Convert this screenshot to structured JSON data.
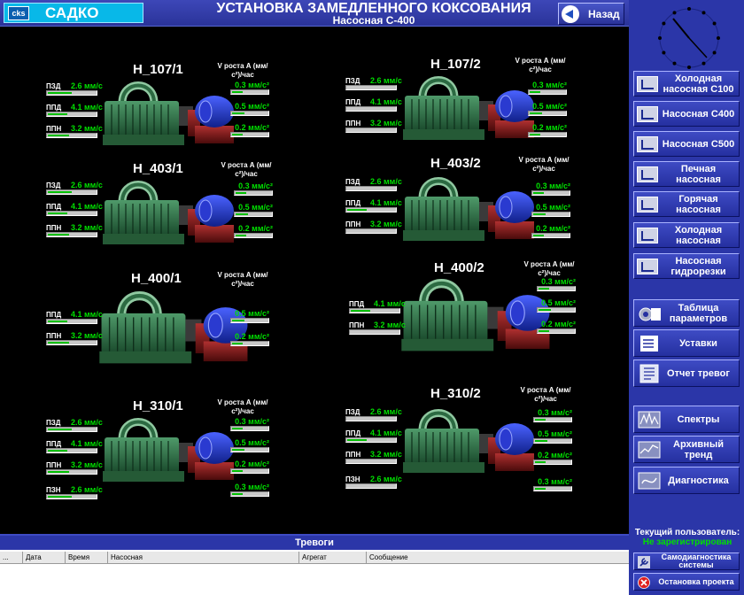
{
  "header": {
    "logo_text": "САДКО",
    "logo_icon": "cks",
    "title": "УСТАНОВКА ЗАМЕДЛЕННОГО КОКСОВАНИЯ",
    "subtitle": "Насосная С-400",
    "back_label": "Назад",
    "accent": "#2b36a8"
  },
  "pumps": [
    {
      "name": "Н_107/1",
      "vhead": "V роста А (мм/с²)/час",
      "sensors": [
        {
          "label": "ПЗД",
          "value": "2.6 мм/с",
          "fill": 0.5
        },
        {
          "label": "ППД",
          "value": "4.1 мм/с",
          "fill": 0.4
        },
        {
          "label": "ППН",
          "value": "3.2 мм/с",
          "fill": 0.45
        }
      ],
      "v": [
        {
          "value": "0.3 мм/с²",
          "fill": 0.3
        },
        {
          "value": "0.5 мм/с²",
          "fill": 0.35
        },
        {
          "value": "0.2 мм/с²",
          "fill": 0.3
        }
      ]
    },
    {
      "name": "Н_107/2",
      "vhead": "V роста А (мм/с²)/час",
      "sensors": [
        {
          "label": "ПЗД",
          "value": "2.6 мм/с",
          "fill": 0.0
        },
        {
          "label": "ППД",
          "value": "4.1 мм/с",
          "fill": 0.0
        },
        {
          "label": "ППН",
          "value": "3.2 мм/с",
          "fill": 0.0
        }
      ],
      "v": [
        {
          "value": "0.3 мм/с²",
          "fill": 0.3
        },
        {
          "value": "0.5 мм/с²",
          "fill": 0.35
        },
        {
          "value": "0.2 мм/с²",
          "fill": 0.3
        }
      ]
    },
    {
      "name": "Н_403/1",
      "vhead": "V роста А (мм/с²)/час",
      "sensors": [
        {
          "label": "ПЗД",
          "value": "2.6 мм/с",
          "fill": 0.5
        },
        {
          "label": "ППД",
          "value": "4.1 мм/с",
          "fill": 0.4
        },
        {
          "label": "ППН",
          "value": "3.2 мм/с",
          "fill": 0.45
        }
      ],
      "v": [
        {
          "value": "0.3 мм/с²",
          "fill": 0.3
        },
        {
          "value": "0.5 мм/с²",
          "fill": 0.35
        },
        {
          "value": "0.2 мм/с²",
          "fill": 0.3
        }
      ]
    },
    {
      "name": "Н_403/2",
      "vhead": "V роста А (мм/с²)/час",
      "sensors": [
        {
          "label": "ПЗД",
          "value": "2.6 мм/с",
          "fill": 0.0
        },
        {
          "label": "ППД",
          "value": "4.1 мм/с",
          "fill": 0.4
        },
        {
          "label": "ППН",
          "value": "3.2 мм/с",
          "fill": 0.0
        }
      ],
      "v": [
        {
          "value": "0.3 мм/с²",
          "fill": 0.3
        },
        {
          "value": "0.5 мм/с²",
          "fill": 0.35
        },
        {
          "value": "0.2 мм/с²",
          "fill": 0.3
        }
      ]
    },
    {
      "name": "Н_400/1",
      "vhead": "V роста А (мм/с²)/час",
      "sensors": [
        {
          "label": "ППД",
          "value": "4.1 мм/с",
          "fill": 0.4
        },
        {
          "label": "ППН",
          "value": "3.2 мм/с",
          "fill": 0.45
        }
      ],
      "v": [
        {
          "value": "0.5 мм/с²",
          "fill": 0.35
        },
        {
          "value": "0.2 мм/с²",
          "fill": 0.3
        }
      ]
    },
    {
      "name": "Н_400/2",
      "vhead": "V роста А (мм/с²)/час",
      "sensors": [
        {
          "label": "ППД",
          "value": "4.1 мм/с",
          "fill": 0.4
        },
        {
          "label": "ППН",
          "value": "3.2 мм/с",
          "fill": 0.0
        }
      ],
      "v": [
        {
          "value": "0.3 мм/с²",
          "fill": 0.3
        },
        {
          "value": "0.5 мм/с²",
          "fill": 0.35
        },
        {
          "value": "0.2 мм/с²",
          "fill": 0.3
        }
      ]
    },
    {
      "name": "Н_310/1",
      "vhead": "V роста А (мм/с²)/час",
      "sensors": [
        {
          "label": "ПЗД",
          "value": "2.6 мм/с",
          "fill": 0.5
        },
        {
          "label": "ППД",
          "value": "4.1 мм/с",
          "fill": 0.4
        },
        {
          "label": "ППН",
          "value": "3.2 мм/с",
          "fill": 0.45
        },
        {
          "label": "ПЗН",
          "value": "2.6 мм/с",
          "fill": 0.5
        }
      ],
      "v": [
        {
          "value": "0.3 мм/с²",
          "fill": 0.3
        },
        {
          "value": "0.5 мм/с²",
          "fill": 0.35
        },
        {
          "value": "0.2 мм/с²",
          "fill": 0.3
        },
        {
          "value": "0.3 мм/с²",
          "fill": 0.3
        }
      ]
    },
    {
      "name": "Н_310/2",
      "vhead": "V роста А (мм/с²)/час",
      "sensors": [
        {
          "label": "ПЗД",
          "value": "2.6 мм/с",
          "fill": 0.0
        },
        {
          "label": "ППД",
          "value": "4.1 мм/с",
          "fill": 0.4
        },
        {
          "label": "ППН",
          "value": "3.2 мм/с",
          "fill": 0.0
        },
        {
          "label": "ПЗН",
          "value": "2.6 мм/с",
          "fill": 0.0
        }
      ],
      "v": [
        {
          "value": "0.3 мм/с²",
          "fill": 0.3
        },
        {
          "value": "0.5 мм/с²",
          "fill": 0.35
        },
        {
          "value": "0.2 мм/с²",
          "fill": 0.3
        },
        {
          "value": "0.3 мм/с²",
          "fill": 0.3
        }
      ]
    }
  ],
  "nav": [
    {
      "label": "Холодная насосная С100",
      "icon": "arrow-screen-icon"
    },
    {
      "label": "Насосная С400",
      "icon": "arrow-screen-icon"
    },
    {
      "label": "Насосная С500",
      "icon": "arrow-screen-icon"
    },
    {
      "label": "Печная насосная",
      "icon": "arrow-screen-icon"
    },
    {
      "label": "Горячая насосная",
      "icon": "arrow-screen-icon"
    },
    {
      "label": "Холодная насосная",
      "icon": "arrow-screen-icon"
    },
    {
      "label": "Насосная гидрорезки",
      "icon": "arrow-screen-icon"
    }
  ],
  "tools": [
    {
      "label": "Таблица параметров",
      "icon": "gear-table-icon"
    },
    {
      "label": "Уставки",
      "icon": "checklist-icon"
    },
    {
      "label": "Отчет тревог",
      "icon": "report-icon"
    },
    {
      "label": "Спектры",
      "icon": "spectrum-icon"
    },
    {
      "label": "Архивный тренд",
      "icon": "trend-icon"
    },
    {
      "label": "Диагностика",
      "icon": "diagnostics-icon"
    }
  ],
  "user": {
    "label": "Текущий пользователь:",
    "value": "Не зарегистрирован"
  },
  "system": {
    "self_diag": "Самодиагностика системы",
    "stop": "Остановка проекта"
  },
  "alarms": {
    "title": "Тревоги",
    "columns": [
      "...",
      "Дата",
      "Время",
      "Насосная",
      "Агрегат",
      "Сообщение"
    ]
  }
}
